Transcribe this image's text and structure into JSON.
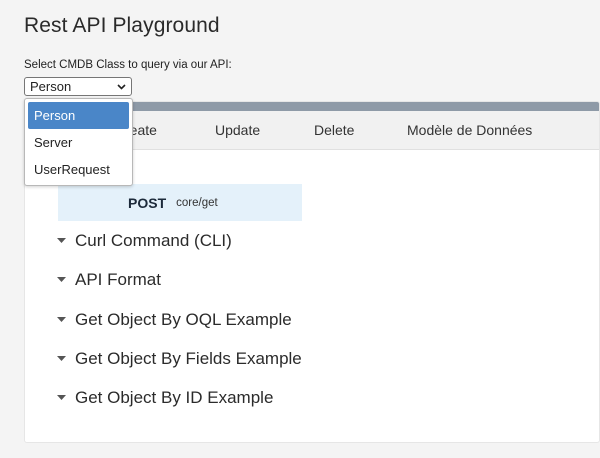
{
  "page": {
    "title": "Rest API Playground"
  },
  "class_selector": {
    "label": "Select CMDB Class to query via our API:",
    "selected": "Person",
    "options": [
      "Person",
      "Server",
      "UserRequest"
    ]
  },
  "tabs": [
    {
      "label": "reate"
    },
    {
      "label": "Update"
    },
    {
      "label": "Delete"
    },
    {
      "label": "Modèle de Données"
    }
  ],
  "endpoint": {
    "method": "POST",
    "path": "core/get"
  },
  "sections": [
    {
      "label": "Curl Command (CLI)"
    },
    {
      "label": "API Format"
    },
    {
      "label": "Get Object By OQL Example"
    },
    {
      "label": "Get Object By Fields Example"
    },
    {
      "label": "Get Object By ID Example"
    }
  ],
  "colors": {
    "selected_option": "#4a86c8",
    "topbar": "#8e9aa7",
    "endpoint_bg": "#e4f1fa"
  }
}
